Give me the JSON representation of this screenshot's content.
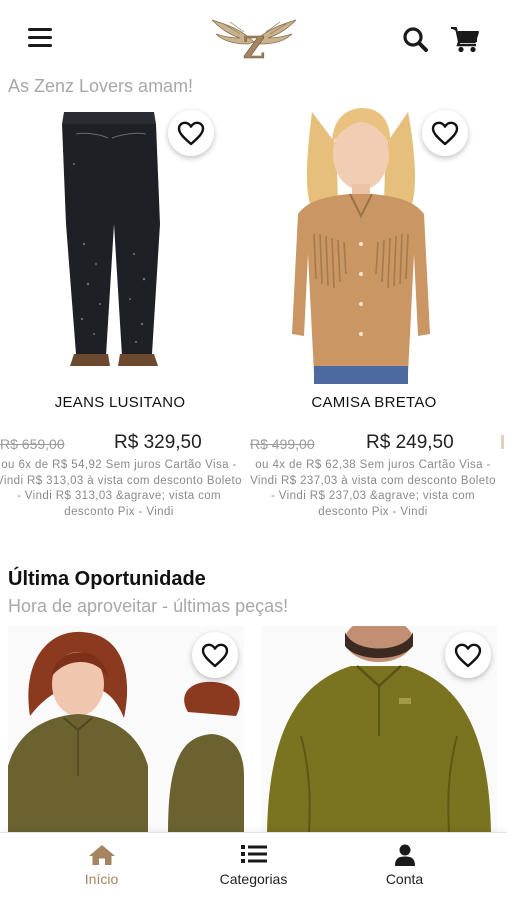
{
  "header": {
    "menu_icon": "hamburger-menu-icon",
    "logo_letter": "Z",
    "search_icon": "search-icon",
    "cart_icon": "cart-icon"
  },
  "lovers": {
    "subtitle": "As Zenz Lovers amam!",
    "products": [
      {
        "name": "JEANS LUSITANO",
        "old_price": "R$ 659,00",
        "price": "R$ 329,50",
        "installments": "ou 6x de R$ 54,92 Sem juros Cartão Visa - Vindi R$ 313,03 à vista com desconto Boleto - Vindi R$ 313,03 &agrave; vista com desconto Pix - Vindi"
      },
      {
        "name": "CAMISA BRETAO",
        "old_price": "R$ 499,00",
        "price": "R$ 249,50",
        "installments": "ou 4x de R$ 62,38 Sem juros Cartão Visa - Vindi R$ 237,03 à vista com desconto Boleto - Vindi R$ 237,03 &agrave; vista com desconto Pix - Vindi"
      }
    ]
  },
  "last_chance": {
    "title": "Última Oportunidade",
    "subtitle": "Hora de aproveitar - últimas peças!"
  },
  "tabbar": {
    "tabs": [
      {
        "label": "Início",
        "icon": "home-icon",
        "active": true
      },
      {
        "label": "Categorias",
        "icon": "list-icon",
        "active": false
      },
      {
        "label": "Conta",
        "icon": "user-icon",
        "active": false
      }
    ]
  },
  "colors": {
    "accent": "#a58561",
    "muted_text": "#a8a8a8",
    "price_text": "#222222",
    "olive": "#6b6422"
  }
}
